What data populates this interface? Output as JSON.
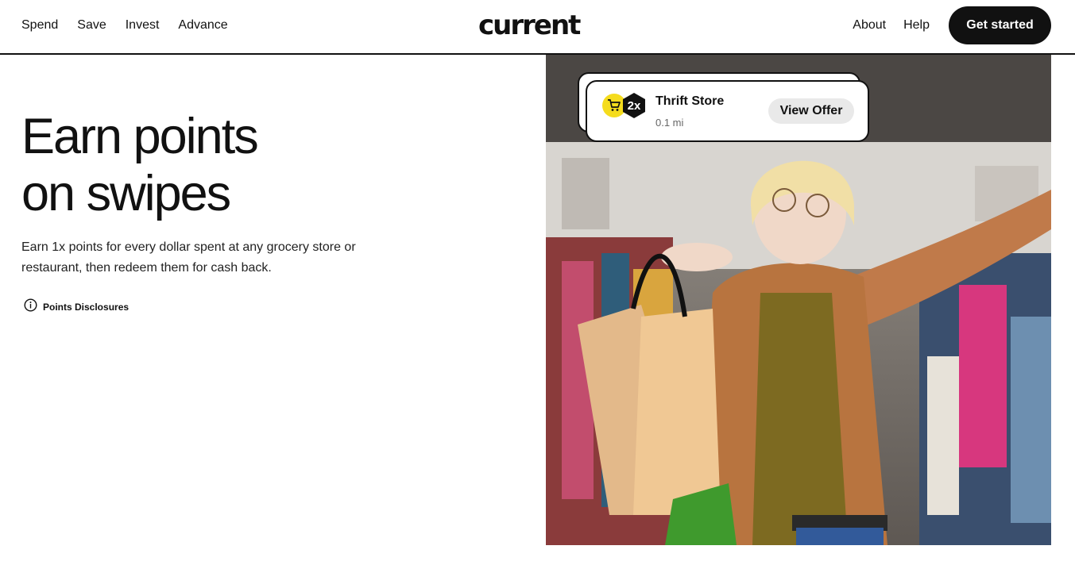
{
  "header": {
    "nav_left": [
      "Spend",
      "Save",
      "Invest",
      "Advance"
    ],
    "logo": "current",
    "nav_right": [
      "About",
      "Help"
    ],
    "cta": "Get started"
  },
  "hero": {
    "headline_line1": "Earn points",
    "headline_line2": "on swipes",
    "subtext": "Earn 1x points for every dollar spent at any grocery store or restaurant, then redeem them for cash back.",
    "disclosure": "Points Disclosures",
    "disclosure_icon": "info-circle-icon"
  },
  "offer_card": {
    "multiplier": "2x",
    "store_name": "Thrift Store",
    "distance": "0.1 mi",
    "button": "View Offer",
    "cart_icon": "shopping-cart-icon",
    "cart_badge_color": "#f5dc1d"
  },
  "colors": {
    "text": "#111111",
    "cta_background": "#111111",
    "offer_button_background": "#e9e9e9"
  }
}
